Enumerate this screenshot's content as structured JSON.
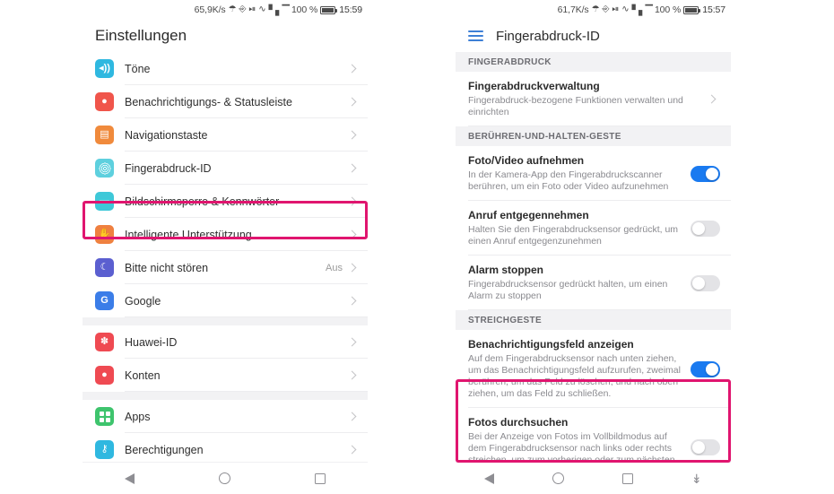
{
  "colors": {
    "highlight_pink": "#e0156f",
    "toggle_on": "#1a7af0",
    "toggle_off": "#e3e3e6",
    "section_bg": "#f2f2f4"
  },
  "left_phone": {
    "statusbar": {
      "speed": "65,9K/s",
      "bluetooth_icon": "bluetooth-icon",
      "nfc_icon": "nfc-icon",
      "vibrate_icon": "vibrate-icon",
      "wifi_icon": "wifi-icon",
      "signal_icon": "signal-icon",
      "battery_percent": "100 %",
      "time": "15:59"
    },
    "title": "Einstellungen",
    "groups": [
      {
        "items": [
          {
            "label": "Töne",
            "icon": "speaker-icon",
            "glyph": "◂))",
            "icon_color": "#2fb8e0",
            "chevron": true,
            "value": "",
            "highlighted": false
          },
          {
            "label": "Benachrichtigungs- & Statusleiste",
            "icon": "bell-icon",
            "glyph": "●",
            "icon_color": "#f0554b",
            "chevron": true,
            "value": "",
            "highlighted": false
          },
          {
            "label": "Navigationstaste",
            "icon": "navigation-key-icon",
            "glyph": "▤",
            "icon_color": "#f08a3c",
            "chevron": true,
            "value": "",
            "highlighted": false
          },
          {
            "label": "Fingerabdruck-ID",
            "icon": "fingerprint-icon",
            "glyph": "",
            "icon_color": "#5ed0de",
            "chevron": true,
            "value": "",
            "highlighted": true
          },
          {
            "label": "Bildschirmsperre & Kennwörter",
            "icon": "lock-icon",
            "glyph": "▬",
            "icon_color": "#3ec8d8",
            "chevron": true,
            "value": "",
            "highlighted": false
          },
          {
            "label": "Intelligente Unterstützung",
            "icon": "hand-icon",
            "glyph": "✋",
            "icon_color": "#ef8040",
            "chevron": true,
            "value": "",
            "highlighted": false
          },
          {
            "label": "Bitte nicht stören",
            "icon": "moon-icon",
            "glyph": "☾",
            "icon_color": "#5b5fd0",
            "chevron": true,
            "value": "Aus",
            "highlighted": false
          },
          {
            "label": "Google",
            "icon": "google-icon",
            "glyph": "G",
            "icon_color": "#3b7de8",
            "chevron": true,
            "value": "",
            "highlighted": false
          }
        ]
      },
      {
        "items": [
          {
            "label": "Huawei-ID",
            "icon": "huawei-logo-icon",
            "glyph": "✽",
            "icon_color": "#ef4a52",
            "chevron": true,
            "value": "",
            "highlighted": false
          },
          {
            "label": "Konten",
            "icon": "account-icon",
            "glyph": "●",
            "icon_color": "#ef4a52",
            "chevron": true,
            "value": "",
            "highlighted": false
          }
        ]
      },
      {
        "items": [
          {
            "label": "Apps",
            "icon": "apps-grid-icon",
            "glyph": "",
            "icon_color": "#3ec46d",
            "chevron": true,
            "value": "",
            "highlighted": false
          },
          {
            "label": "Berechtigungen",
            "icon": "key-icon",
            "glyph": "⚷",
            "icon_color": "#2fb8e0",
            "chevron": true,
            "value": "",
            "highlighted": false
          }
        ]
      }
    ],
    "navbar": {
      "back": "back-icon",
      "home": "home-icon",
      "recents": "recents-icon"
    }
  },
  "right_phone": {
    "statusbar": {
      "speed": "61,7K/s",
      "bluetooth_icon": "bluetooth-icon",
      "nfc_icon": "nfc-icon",
      "vibrate_icon": "vibrate-icon",
      "wifi_icon": "wifi-icon",
      "signal_icon": "signal-icon",
      "battery_percent": "100 %",
      "time": "15:57"
    },
    "menu_icon": "hamburger-menu-icon",
    "title": "Fingerabdruck-ID",
    "sections": [
      {
        "header": "FINGERABDRUCK",
        "items": [
          {
            "title": "Fingerabdruckverwaltung",
            "subtitle": "Fingerabdruck-bezogene Funktionen verwalten und einrichten",
            "control": "chevron",
            "toggle_on": false,
            "highlighted": false
          }
        ]
      },
      {
        "header": "BERÜHREN-UND-HALTEN-GESTE",
        "items": [
          {
            "title": "Foto/Video aufnehmen",
            "subtitle": "In der Kamera-App den Fingerabdruckscanner berühren, um ein Foto oder Video aufzunehmen",
            "control": "toggle",
            "toggle_on": true,
            "highlighted": false
          },
          {
            "title": "Anruf entgegennehmen",
            "subtitle": "Halten Sie den Fingerabdrucksensor gedrückt, um einen Anruf entgegenzunehmen",
            "control": "toggle",
            "toggle_on": false,
            "highlighted": false
          },
          {
            "title": "Alarm stoppen",
            "subtitle": "Fingerabdrucksensor gedrückt halten, um einen Alarm zu stoppen",
            "control": "toggle",
            "toggle_on": false,
            "highlighted": false
          }
        ]
      },
      {
        "header": "STREICHGESTE",
        "items": [
          {
            "title": "Benachrichtigungsfeld anzeigen",
            "subtitle": "Auf dem Fingerabdrucksensor nach unten ziehen, um das Benachrichtigungsfeld aufzurufen, zweimal berühren, um das Feld zu löschen, und nach oben ziehen, um das Feld zu schließen.",
            "control": "toggle",
            "toggle_on": true,
            "highlighted": true
          },
          {
            "title": "Fotos durchsuchen",
            "subtitle": "Bei der Anzeige von Fotos im Vollbildmodus auf dem Fingerabdrucksensor nach links oder rechts streichen, um zum vorherigen oder zum nächsten Foto zu wechseln",
            "control": "toggle",
            "toggle_on": false,
            "highlighted": false
          }
        ]
      }
    ],
    "navbar": {
      "back": "back-icon",
      "home": "home-icon",
      "recents": "recents-icon",
      "extra": "collapse-icon"
    }
  }
}
